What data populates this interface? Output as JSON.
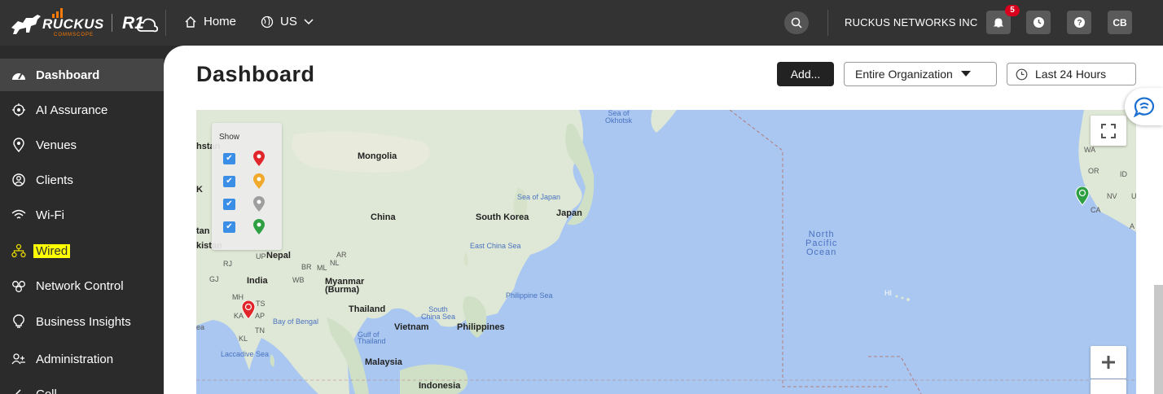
{
  "header": {
    "brand_word": "RUCKUS",
    "brand_sub": "COMMSCOPE",
    "product": "R1",
    "home_label": "Home",
    "region_label": "US",
    "org_name": "RUCKUS NETWORKS INC",
    "notification_count": "5",
    "avatar_initials": "CB",
    "colors": {
      "bar_bg": "#333333",
      "badge": "#d8001c",
      "brand_accent": "#ff7a00"
    },
    "icons": [
      "search-icon",
      "bell-icon",
      "clock-icon",
      "help-icon"
    ]
  },
  "sidebar": {
    "items": [
      {
        "label": "Dashboard",
        "icon": "gauge-icon",
        "active": true
      },
      {
        "label": "AI Assurance",
        "icon": "ai-brain-icon"
      },
      {
        "label": "Venues",
        "icon": "location-pin-icon"
      },
      {
        "label": "Clients",
        "icon": "client-face-icon"
      },
      {
        "label": "Wi-Fi",
        "icon": "wifi-icon"
      },
      {
        "label": "Wired",
        "icon": "wired-network-icon",
        "highlighted": true
      },
      {
        "label": "Network Control",
        "icon": "network-control-icon"
      },
      {
        "label": "Business Insights",
        "icon": "lightbulb-icon"
      },
      {
        "label": "Administration",
        "icon": "admin-users-icon"
      },
      {
        "label": "Coll...",
        "icon": "collapse-icon"
      }
    ]
  },
  "main": {
    "title": "Dashboard",
    "add_button": "Add...",
    "scope_select": "Entire Organization",
    "time_range": "Last 24 Hours"
  },
  "map": {
    "legend_title": "Show",
    "legend_pins": [
      {
        "color": "#e0262b"
      },
      {
        "color": "#f0a92a"
      },
      {
        "color": "#9e9e9e"
      },
      {
        "color": "#2ea043"
      }
    ],
    "labels": {
      "sea_of_okhotsk": "Sea of\nOkhotsk",
      "mongolia": "Mongolia",
      "sea_of_japan": "Sea of Japan",
      "china": "China",
      "south_korea": "South Korea",
      "japan": "Japan",
      "east_china_sea": "East China Sea",
      "nepal": "Nepal",
      "india": "India",
      "myanmar": "Myanmar\n(Burma)",
      "thailand": "Thailand",
      "south_china_sea": "South\nChina Sea",
      "bay_of_bengal": "Bay of Bengal",
      "vietnam": "Vietnam",
      "philippines": "Philippines",
      "philippine_sea": "Philippine Sea",
      "gulf_of_thailand": "Gulf of\nThailand",
      "laccadive_sea": "Laccadive Sea",
      "malaysia": "Malaysia",
      "indonesia": "Indonesia",
      "north_pacific_ocean": "North\nPacific\nOcean",
      "hi": "HI",
      "wa": "WA",
      "or": "OR",
      "id": "ID",
      "nv": "NV",
      "ca": "CA",
      "stan": "hstan",
      "kistan": "kistan",
      "tan": "tan",
      "k": "K",
      "a": "A",
      "rj": "RJ",
      "up": "UP",
      "gj": "GJ",
      "mh": "MH",
      "ka": "KA",
      "tn": "TN",
      "kl": "KL",
      "ts": "TS",
      "ap": "AP",
      "br": "BR",
      "ml": "ML",
      "nl": "NL",
      "ar": "AR",
      "wb": "WB",
      "ea": "ea",
      "u": "U"
    },
    "pins_on_map": [
      {
        "place": "India (KA)",
        "color": "#e0262b"
      },
      {
        "place": "California (CA)",
        "color": "#2ea043"
      }
    ]
  }
}
